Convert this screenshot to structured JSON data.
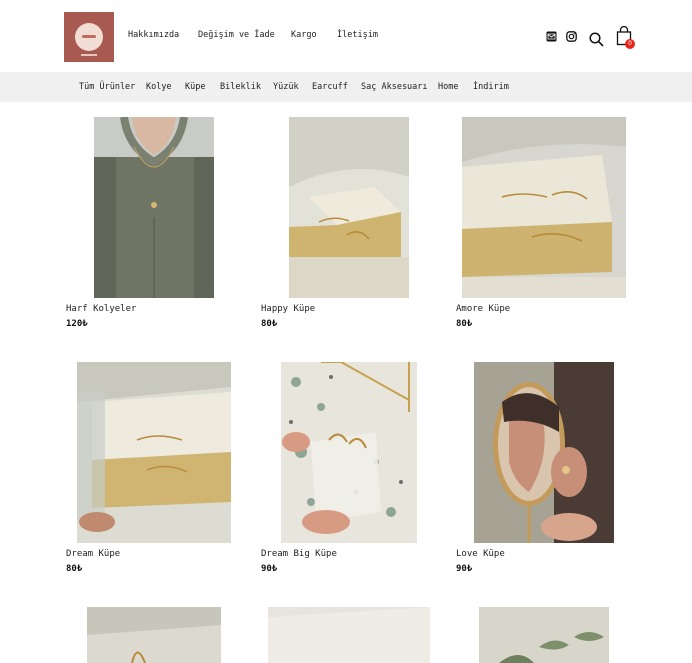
{
  "header": {
    "nav": [
      "Hakkımızda",
      "Değişim ve İade",
      "Kargo",
      "İletişim"
    ],
    "icons": [
      "mail-icon",
      "instagram-icon",
      "search-icon",
      "shopping-bag-icon"
    ],
    "cart_count": "0",
    "colors": {
      "logo_bg": "#a85a50",
      "badge": "#e8261c",
      "catbar_bg": "#f0f0f0"
    }
  },
  "categories": [
    "Tüm Ürünler",
    "Kolye",
    "Küpe",
    "Bileklik",
    "Yüzük",
    "Earcuff",
    "Saç Aksesuarı",
    "Home",
    "İndirim"
  ],
  "products": [
    {
      "name": "Harf Kolyeler",
      "price": "120₺"
    },
    {
      "name": "Happy Küpe",
      "price": "80₺"
    },
    {
      "name": "Amore Küpe",
      "price": "80₺"
    },
    {
      "name": "Dream Küpe",
      "price": "80₺"
    },
    {
      "name": "Dream Big Küpe",
      "price": "90₺"
    },
    {
      "name": "Love Küpe",
      "price": "90₺"
    }
  ]
}
